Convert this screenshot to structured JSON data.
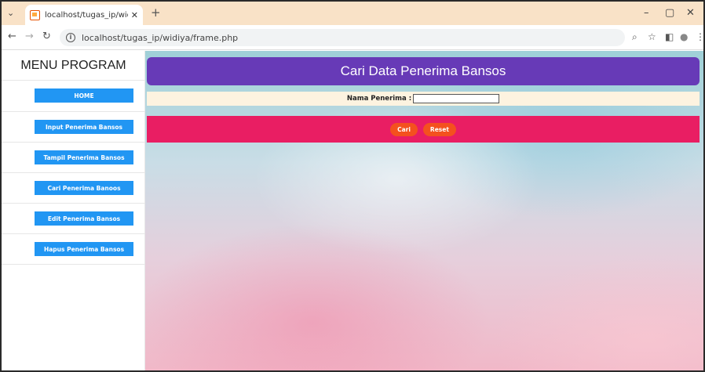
{
  "browser": {
    "tab_title": "localhost/tugas_ip/widiya/fram",
    "tab_close": "✕",
    "new_tab": "+",
    "url": "localhost/tugas_ip/widiya/frame.php",
    "icons": {
      "tab_menu": "chevron-down-icon",
      "favicon": "page-favicon-icon",
      "back": "back-arrow-icon",
      "forward": "forward-arrow-icon",
      "reload": "reload-icon",
      "info": "site-info-icon",
      "zoom": "zoom-icon",
      "bookmark": "star-icon",
      "sidebar": "sidebar-icon",
      "profile": "profile-icon",
      "menu": "kebab-menu-icon",
      "minimize": "minimize-icon",
      "restore": "restore-icon",
      "close": "close-icon"
    }
  },
  "sidebar": {
    "title": "MENU PROGRAM",
    "items": [
      {
        "label": "HOME"
      },
      {
        "label": "Input Penerima Bansos"
      },
      {
        "label": "Tampil Penerima Bansos"
      },
      {
        "label": "Cari Penerima Banoos"
      },
      {
        "label": "Edit Penerima Bansos"
      },
      {
        "label": "Hapus Penerima Bansos"
      }
    ]
  },
  "main": {
    "heading": "Cari Data Penerima Bansos",
    "search_label": "Nama Penerima :",
    "search_value": "",
    "buttons": {
      "search": "Cari",
      "reset": "Reset"
    }
  },
  "colors": {
    "tabbar": "#f9e2c7",
    "menu_button": "#2196f3",
    "header": "#673ab7",
    "action_bar": "#e91e63",
    "action_button": "#f4511e",
    "search_row": "#fdf3e0"
  }
}
